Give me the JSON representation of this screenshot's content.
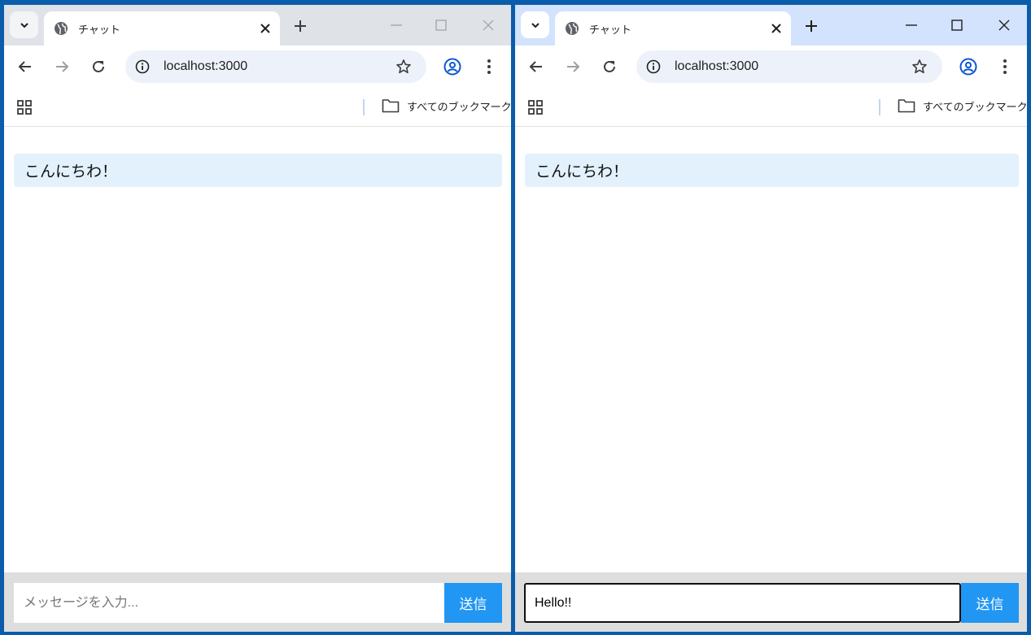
{
  "windows": {
    "left": {
      "tab_title": "チャット",
      "url": "localhost:3000",
      "bookmarks_label": "すべてのブックマーク",
      "message": "こんにちわ！",
      "input_value": "",
      "input_placeholder": "メッセージを入力...",
      "send_label": "送信",
      "active": false
    },
    "right": {
      "tab_title": "チャット",
      "url": "localhost:3000",
      "bookmarks_label": "すべてのブックマーク",
      "message": "こんにちわ！",
      "input_value": "Hello!!",
      "input_placeholder": "メッセージを入力...",
      "send_label": "送信",
      "active": true
    }
  },
  "colors": {
    "desktop": "#0b5cab",
    "inactive_frame": "#dfe3e8",
    "active_frame": "#d3e3fd",
    "message_bubble": "#e3f1fc",
    "send_button": "#2196f3",
    "input_bar": "#dedede"
  },
  "icons": [
    "tab-search-icon",
    "globe-icon",
    "close-icon",
    "plus-icon",
    "minimize-icon",
    "maximize-icon",
    "back-icon",
    "forward-icon",
    "reload-icon",
    "info-icon",
    "star-icon",
    "profile-icon",
    "menu-icon",
    "apps-icon",
    "folder-icon"
  ]
}
